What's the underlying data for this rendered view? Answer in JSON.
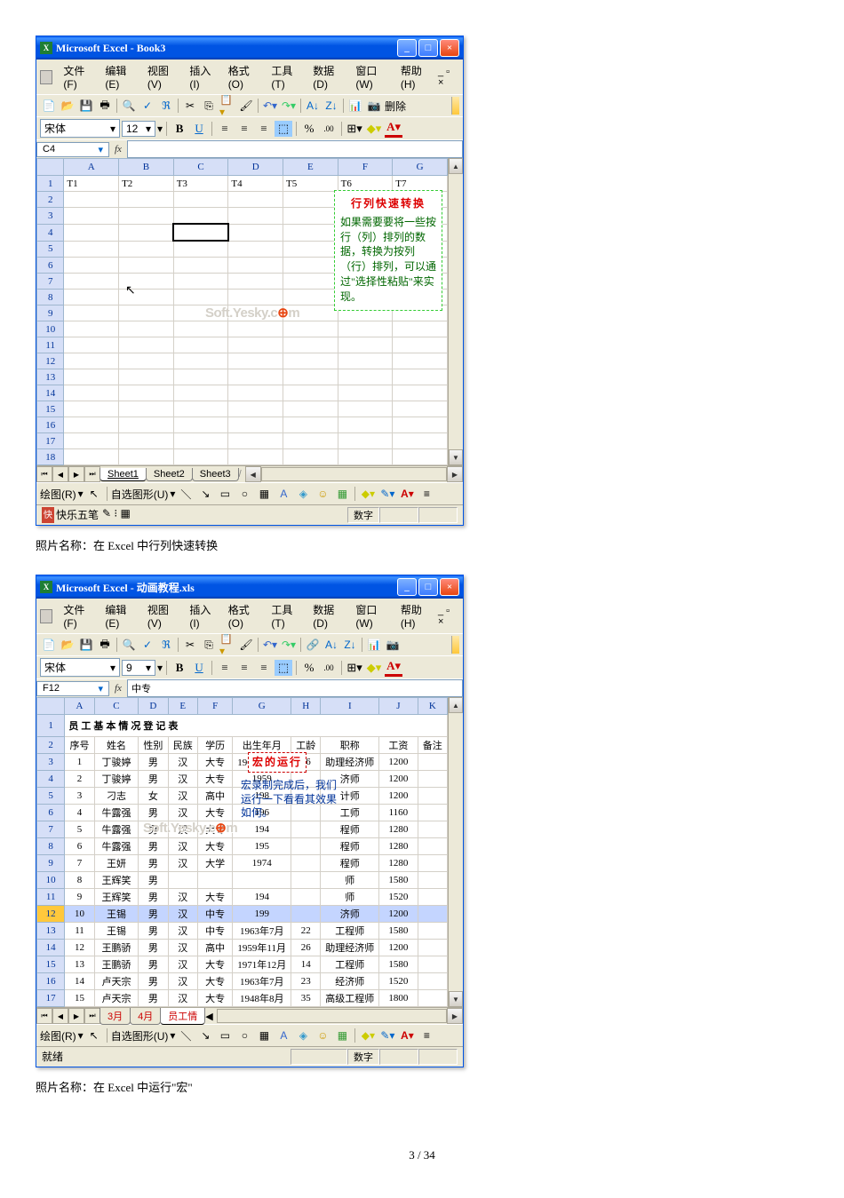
{
  "excel1": {
    "title": "Microsoft Excel - Book3",
    "menus": [
      "文件(F)",
      "编辑(E)",
      "视图(V)",
      "插入(I)",
      "格式(O)",
      "工具(T)",
      "数据(D)",
      "窗口(W)",
      "帮助(H)"
    ],
    "toolbar_extra": "删除",
    "font": "宋体",
    "font_size": "12",
    "activeCell": "C4",
    "formula": "",
    "cols": [
      "A",
      "B",
      "C",
      "D",
      "E",
      "F",
      "G"
    ],
    "rowcount": 18,
    "row1": [
      "T1",
      "T2",
      "T3",
      "T4",
      "T5",
      "T6",
      "T7"
    ],
    "sheets": [
      "Sheet1",
      "Sheet2",
      "Sheet3"
    ],
    "active_sheet": 0,
    "draw_label": "绘图(R)",
    "autoshape": "自选图形(U)",
    "statusbar_left": "快乐五笔",
    "statusbar_right": "数字",
    "callout": {
      "title": "行列快速转换",
      "body": "如果需要要将一些按行（列）排列的数据，转换为按列（行）排列，可以通过\"选择性粘贴\"来实现。"
    },
    "watermark": "Soft.Yesky.c"
  },
  "caption1": "照片名称：在 Excel 中行列快速转换",
  "excel2": {
    "title": "Microsoft Excel - 动画教程.xls",
    "menus": [
      "文件(F)",
      "编辑(E)",
      "视图(V)",
      "插入(I)",
      "格式(O)",
      "工具(T)",
      "数据(D)",
      "窗口(W)",
      "帮助(H)"
    ],
    "font": "宋体",
    "font_size": "9",
    "activeCell": "F12",
    "formula": "中专",
    "cols": [
      "A",
      "C",
      "D",
      "E",
      "F",
      "G",
      "H",
      "I",
      "J",
      "K"
    ],
    "big_title": "员工基本情况登记表",
    "headers": [
      "序号",
      "姓名",
      "性别",
      "民族",
      "学历",
      "出生年月",
      "工龄",
      "职称",
      "工资",
      "备注"
    ],
    "rows": [
      [
        "1",
        "丁骏婷",
        "男",
        "汉",
        "大专",
        "1960年12月",
        "26",
        "助理经济师",
        "1200",
        ""
      ],
      [
        "2",
        "丁骏婷",
        "男",
        "汉",
        "大专",
        "1959",
        "",
        "济师",
        "1200",
        ""
      ],
      [
        "3",
        "刁志",
        "女",
        "汉",
        "高中",
        "198",
        "",
        "计师",
        "1200",
        ""
      ],
      [
        "4",
        "牛露强",
        "男",
        "汉",
        "大专",
        "196",
        "",
        "工师",
        "1160",
        ""
      ],
      [
        "5",
        "牛露强",
        "男",
        "汉",
        "大专",
        "194",
        "",
        "程师",
        "1280",
        ""
      ],
      [
        "6",
        "牛露强",
        "男",
        "汉",
        "大专",
        "195",
        "",
        "程师",
        "1280",
        ""
      ],
      [
        "7",
        "王妍",
        "男",
        "汉",
        "大学",
        "1974",
        "",
        "程师",
        "1280",
        ""
      ],
      [
        "8",
        "王辉笑",
        "男",
        "",
        "",
        "",
        "",
        "师",
        "1580",
        ""
      ],
      [
        "9",
        "王辉笑",
        "男",
        "汉",
        "大专",
        "194",
        "",
        "师",
        "1520",
        ""
      ],
      [
        "10",
        "王锡",
        "男",
        "汉",
        "中专",
        "199",
        "",
        "济师",
        "1200",
        ""
      ],
      [
        "11",
        "王锡",
        "男",
        "汉",
        "中专",
        "1963年7月",
        "22",
        "工程师",
        "1580",
        ""
      ],
      [
        "12",
        "王鹏骄",
        "男",
        "汉",
        "高中",
        "1959年11月",
        "26",
        "助理经济师",
        "1200",
        ""
      ],
      [
        "13",
        "王鹏骄",
        "男",
        "汉",
        "大专",
        "1971年12月",
        "14",
        "工程师",
        "1580",
        ""
      ],
      [
        "14",
        "卢天宗",
        "男",
        "汉",
        "大专",
        "1963年7月",
        "23",
        "经济师",
        "1520",
        ""
      ],
      [
        "15",
        "卢天宗",
        "男",
        "汉",
        "大专",
        "1948年8月",
        "35",
        "高级工程师",
        "1800",
        ""
      ]
    ],
    "selected_row": 12,
    "sheets": [
      "3月",
      "4月",
      "员工情"
    ],
    "draw_label": "绘图(R)",
    "autoshape": "自选图形(U)",
    "status_left": "就绪",
    "status_right": "数字",
    "callout1": {
      "title": "宏的运行"
    },
    "callout2": {
      "body": "宏录制完成后，我们运行一下看看其效果如何。"
    },
    "watermark": "Soft.Yesky.c"
  },
  "caption2": "照片名称：在 Excel 中运行\"宏\"",
  "page_num": "3 / 34"
}
